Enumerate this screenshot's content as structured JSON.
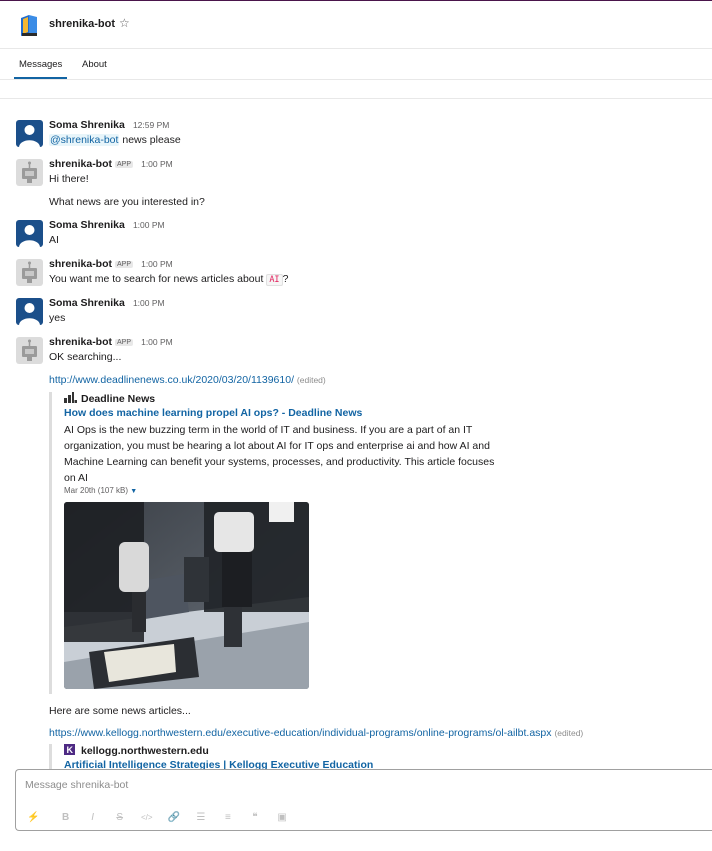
{
  "header": {
    "title": "shrenika-bot",
    "star_icon": "star-outline-icon",
    "logo_icon": "book-logo-icon"
  },
  "tabs": [
    {
      "label": "Messages",
      "active": true
    },
    {
      "label": "About",
      "active": false
    }
  ],
  "messages": [
    {
      "author": "Soma Shrenika",
      "time": "12:59 PM",
      "mention": "@shrenika-bot",
      "text": " news please"
    },
    {
      "author": "shrenika-bot",
      "badge": "APP",
      "time": "1:00 PM",
      "text": "Hi there!",
      "text2": "What news are you interested in?"
    },
    {
      "author": "Soma Shrenika",
      "time": "1:00 PM",
      "text": "AI"
    },
    {
      "author": "shrenika-bot",
      "badge": "APP",
      "time": "1:00 PM",
      "text_before": "You want me to search for news articles about ",
      "code": "AI",
      "text_after": "?"
    },
    {
      "author": "Soma Shrenika",
      "time": "1:00 PM",
      "text": "yes"
    },
    {
      "author": "shrenika-bot",
      "badge": "APP",
      "time": "1:00 PM",
      "text": "OK searching...",
      "link": "http://www.deadlinenews.co.uk/2020/03/20/1139610/",
      "edited": "(edited)",
      "unfurl": {
        "site": "Deadline News",
        "title": "How does machine learning propel AI ops? - Deadline News",
        "desc": "AI Ops is the new buzzing term in the world of IT and business. If you are a part of an IT organization, you must be hearing a lot about AI for IT ops and enterprise ai and how AI and Machine Learning can benefit your systems, processes, and productivity. This article focuses on AI",
        "meta": "Mar 20th (107 kB)"
      },
      "text3": "Here are some news articles...",
      "link2": "https://www.kellogg.northwestern.edu/executive-education/individual-programs/online-programs/ol-ailbt.aspx",
      "edited2": "(edited)",
      "unfurl2": {
        "site": "kellogg.northwestern.edu",
        "title": "Artificial Intelligence Strategies | Kellogg Executive Education"
      }
    }
  ],
  "composer": {
    "placeholder": "Message shrenika-bot"
  },
  "colors": {
    "link": "#1264a3",
    "user_avatar": "#1b4f8a",
    "code": "#e01e5a"
  }
}
